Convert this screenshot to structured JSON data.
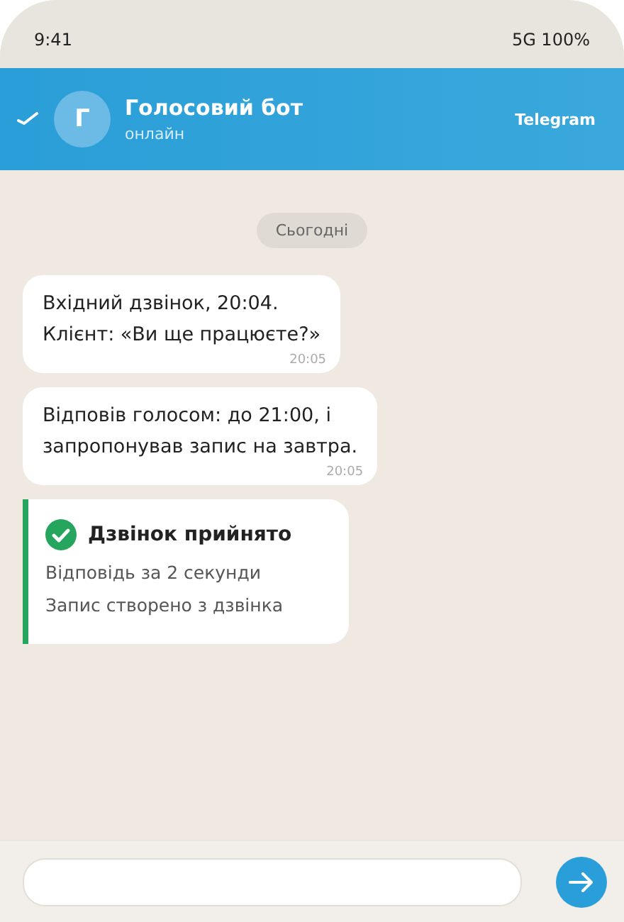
{
  "status_bar": {
    "time": "9:41",
    "network": "5G 100%"
  },
  "header": {
    "avatar_letter": "Г",
    "title": "Голосовий бот",
    "subtitle": "онлайн",
    "app_label": "Telegram"
  },
  "date_chip": "Сьогодні",
  "messages": [
    {
      "kind": "text",
      "lines": [
        "Вхідний дзвінок, 20:04.",
        "Клієнт: «Ви ще працюєте?»"
      ],
      "time": "20:05"
    },
    {
      "kind": "text",
      "lines": [
        "Відповів голосом: до 21:00, і",
        "запропонував запис на завтра."
      ],
      "time": "20:05"
    },
    {
      "kind": "status",
      "title": "Дзвінок прийнято",
      "lines": [
        "Відповідь за 2 секунди",
        "Запис створено з дзвінка"
      ]
    }
  ]
}
